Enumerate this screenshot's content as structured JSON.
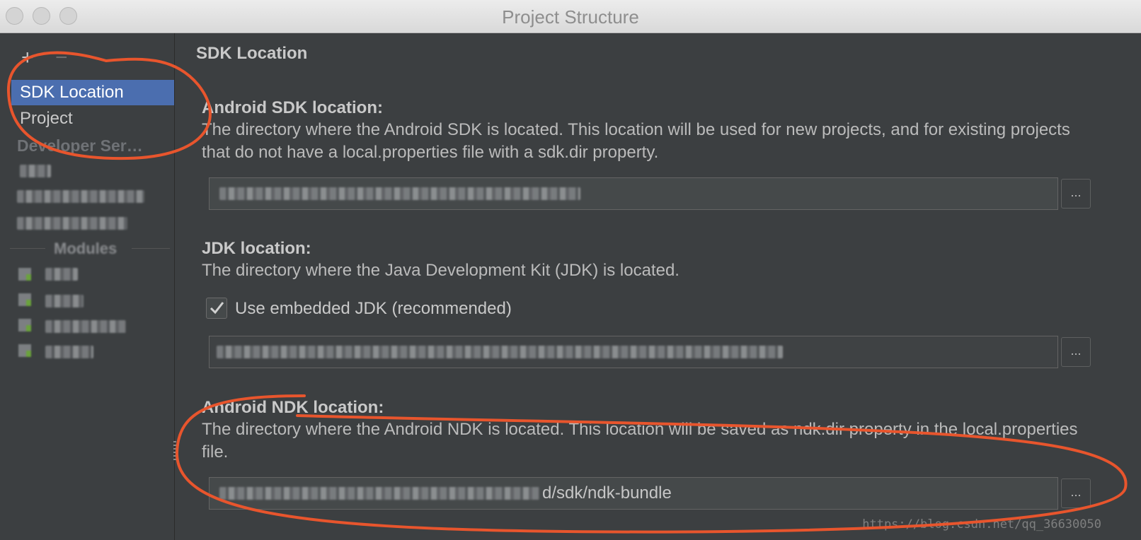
{
  "window": {
    "title": "Project Structure"
  },
  "toolbar": {
    "add_icon": "plus-icon",
    "add_glyph": "+",
    "remove_icon": "minus-icon",
    "remove_glyph": "−"
  },
  "sidebar": {
    "items": [
      {
        "label": "SDK Location",
        "selected": true
      },
      {
        "label": "Project",
        "selected": false
      }
    ],
    "group_label": "Developer Ser…",
    "modules_label": "Modules"
  },
  "main": {
    "page_title": "SDK Location",
    "sdk": {
      "title": "Android SDK location:",
      "description": "The directory where the Android SDK is located. This location will be used for new projects, and for existing projects that do not have a local.properties file with a sdk.dir property.",
      "browse_label": "..."
    },
    "jdk": {
      "title": "JDK location:",
      "description": "The directory where the Java Development Kit (JDK) is located.",
      "checkbox_label": "Use embedded JDK (recommended)",
      "checkbox_checked": true,
      "browse_label": "..."
    },
    "ndk": {
      "title": "Android NDK location:",
      "description": "The directory where the Android NDK is located. This location will be saved as ndk.dir property in the local.properties file.",
      "value_visible": "d/sdk/ndk-bundle",
      "browse_label": "..."
    }
  },
  "watermark": "https://blog.csdn.net/qq_36630050",
  "colors": {
    "selection": "#4b6eaf",
    "background": "#3c3f41",
    "annotation": "#e8552d"
  }
}
